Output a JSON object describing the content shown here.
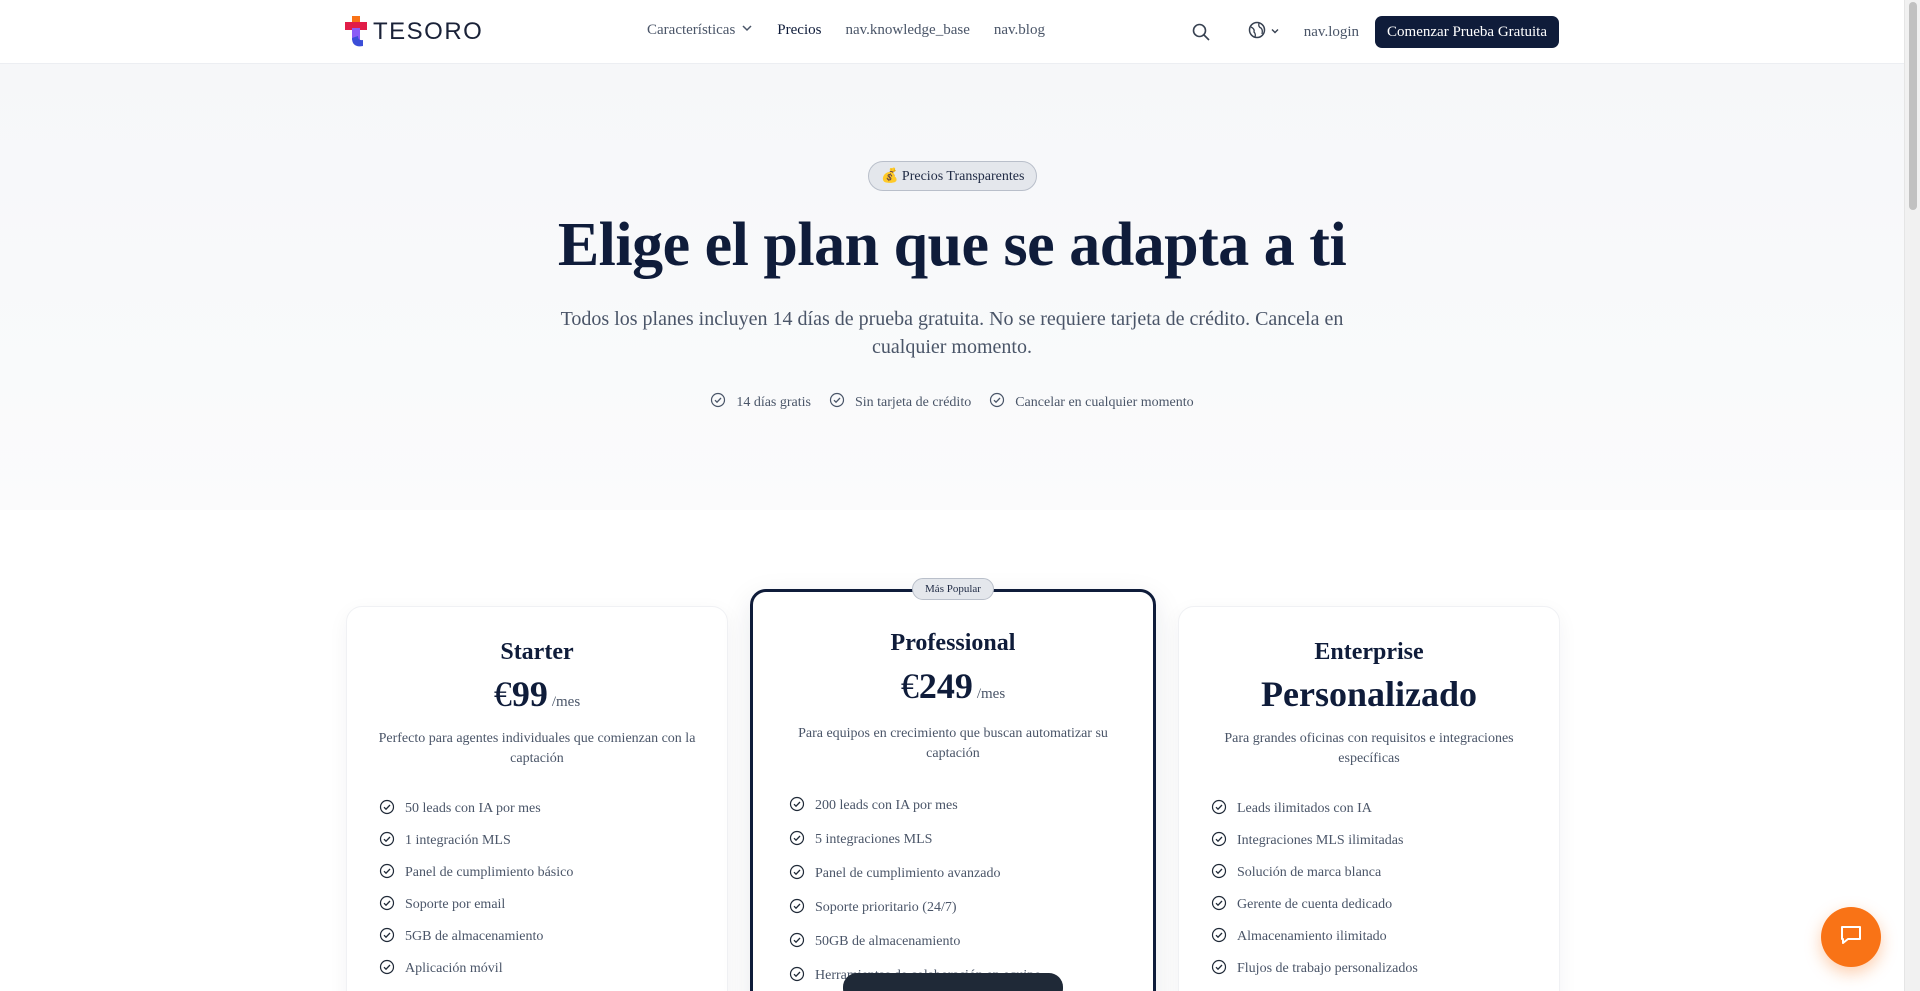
{
  "brand": {
    "name": "TESORO"
  },
  "nav": {
    "links": [
      {
        "label": "Características",
        "has_dropdown": true
      },
      {
        "label": "Precios",
        "active": true
      },
      {
        "label": "nav.knowledge_base"
      },
      {
        "label": "nav.blog"
      }
    ],
    "login": "nav.login",
    "cta": "Comenzar Prueba Gratuita"
  },
  "hero": {
    "badge": "💰 Precios Transparentes",
    "title": "Elige el plan que se adapta a ti",
    "subtitle": "Todos los planes incluyen 14 días de prueba gratuita. No se requiere tarjeta de crédito. Cancela en cualquier momento.",
    "checks": [
      "14 días gratis",
      "Sin tarjeta de crédito",
      "Cancelar en cualquier momento"
    ]
  },
  "plans": [
    {
      "name": "Starter",
      "currency": "€",
      "amount": "99",
      "period": "/mes",
      "description": "Perfecto para agentes individuales que comienzan con la captación",
      "features": [
        "50 leads con IA por mes",
        "1 integración MLS",
        "Panel de cumplimiento básico",
        "Soporte por email",
        "5GB de almacenamiento",
        "Aplicación móvil"
      ]
    },
    {
      "name": "Professional",
      "popular_label": "Más Popular",
      "currency": "€",
      "amount": "249",
      "period": "/mes",
      "description": "Para equipos en crecimiento que buscan automatizar su captación",
      "features": [
        "200 leads con IA por mes",
        "5 integraciones MLS",
        "Panel de cumplimiento avanzado",
        "Soporte prioritario (24/7)",
        "50GB de almacenamiento",
        "Herramientas de colaboración en equipo"
      ]
    },
    {
      "name": "Enterprise",
      "custom_price": "Personalizado",
      "description": "Para grandes oficinas con requisitos e integraciones específicas",
      "features": [
        "Leads ilimitados con IA",
        "Integraciones MLS ilimitadas",
        "Solución de marca blanca",
        "Gerente de cuenta dedicado",
        "Almacenamiento ilimitado",
        "Flujos de trabajo personalizados"
      ]
    }
  ],
  "colors": {
    "primary": "#0f1c3a",
    "accent": "#f97316",
    "muted_text": "#4a5568"
  },
  "icons": {
    "search": "search-icon",
    "language": "globe-icon",
    "check": "check-circle-icon",
    "chat": "chat-icon"
  }
}
